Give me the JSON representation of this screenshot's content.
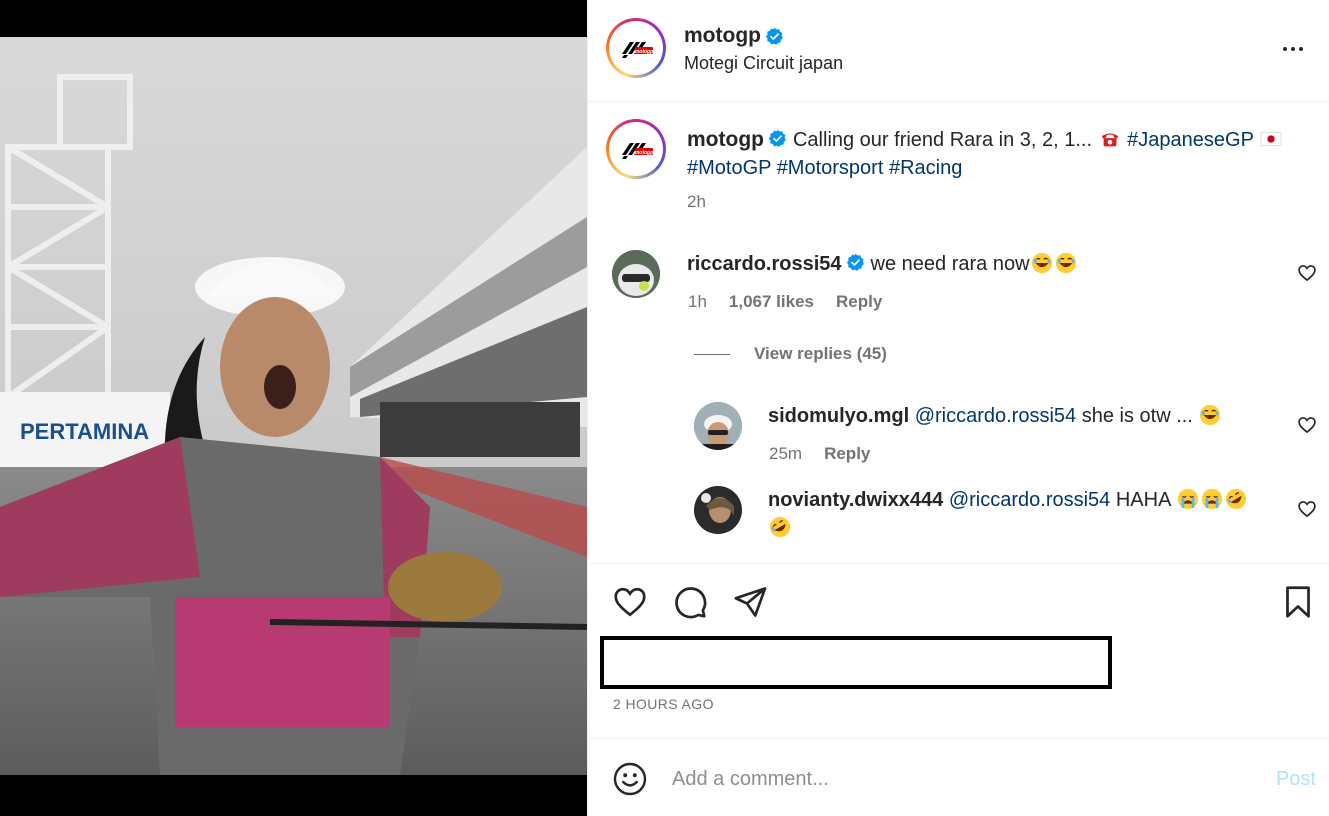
{
  "post": {
    "username": "motogp",
    "location": "Motegi Circuit japan",
    "caption_text": "Calling our friend Rara in 3, 2, 1... ",
    "caption_hashtags": [
      "#JapaneseGP",
      "#MotoGP",
      "#Motorsport",
      "#Racing"
    ],
    "caption_time": "2h",
    "date": "2 HOURS AGO"
  },
  "comments": [
    {
      "username": "riccardo.rossi54",
      "verified": true,
      "text": "we need rara now",
      "time": "1h",
      "likes": "1,067 likes",
      "reply_label": "Reply"
    }
  ],
  "view_replies": "View replies (45)",
  "replies": [
    {
      "username": "sidomulyo.mgl",
      "mention": "@riccardo.rossi54",
      "text": " she is otw ... ",
      "time": "25m",
      "reply_label": "Reply"
    },
    {
      "username": "novianty.dwixx444",
      "mention": "@riccardo.rossi54",
      "text": " HAHA "
    }
  ],
  "comment_box": {
    "placeholder": "Add a comment...",
    "post_label": "Post"
  },
  "colors": {
    "link": "#00376b",
    "verified": "#0095f6",
    "muted": "#737373",
    "post_button": "#b2dffc"
  },
  "icons": [
    "verified-badge-icon",
    "more-icon",
    "heart-icon",
    "comment-icon",
    "share-icon",
    "bookmark-icon",
    "emoji-icon",
    "telephone-emoji",
    "japan-flag-emoji",
    "laughing-emoji",
    "crying-emoji",
    "rofl-emoji"
  ]
}
